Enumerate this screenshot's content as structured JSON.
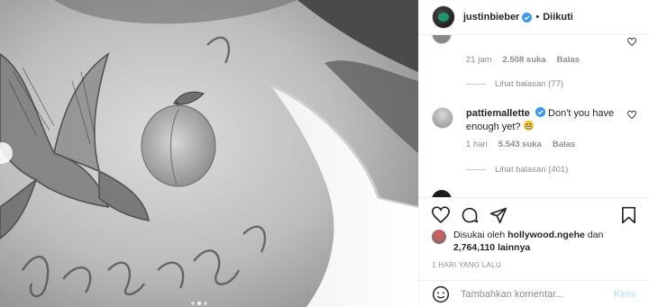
{
  "post": {
    "username": "justinbieber",
    "separator": "•",
    "follow_state": "Diikuti"
  },
  "comments": {
    "first": {
      "time": "21 jam",
      "likes": "2.508 suka",
      "reply": "Balas",
      "view_replies": "Lihat balasan (77)"
    },
    "second": {
      "username": "pattiemallette",
      "text": "Don't you have enough yet?",
      "time": "1 hari",
      "likes": "5.543 suka",
      "reply": "Balas",
      "view_replies": "Lihat balasan (401)"
    }
  },
  "likes": {
    "prefix": "Disukai oleh",
    "liker": "hollywood.ngehe",
    "and": "dan",
    "count": "2,764,110",
    "suffix": "lainnya"
  },
  "time_ago": "1 HARI YANG LALU",
  "add_comment": {
    "placeholder": "Tambahkan komentar...",
    "post_label": "Kirim"
  },
  "icons": {
    "verified": "verified-badge-icon",
    "more": "more-options-icon",
    "like": "heart-icon",
    "comment": "comment-icon",
    "share": "paper-plane-icon",
    "save": "bookmark-icon",
    "emoji": "smiley-icon",
    "carousel_prev": "chevron-left-icon"
  },
  "colors": {
    "verified": "#3897f0",
    "muted": "#8e8e8e",
    "post_button": "#b2dffc",
    "text": "#262626"
  },
  "carousel": {
    "slides": 3,
    "active": 2
  }
}
